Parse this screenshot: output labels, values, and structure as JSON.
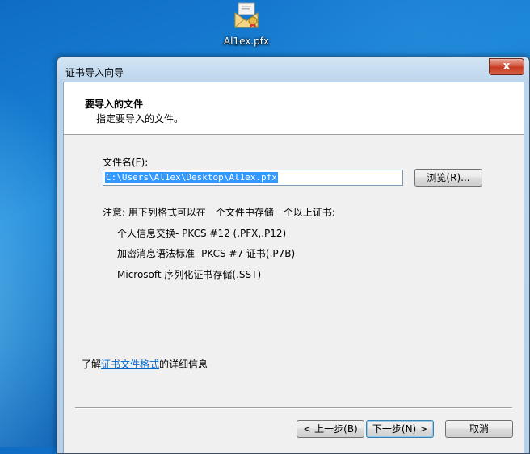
{
  "desktop": {
    "icon_label": "Al1ex.pfx",
    "icon": "certificate-envelope-icon"
  },
  "window": {
    "title": "证书导入向导",
    "close_label": "x"
  },
  "header": {
    "title": "要导入的文件",
    "subtitle": "指定要导入的文件。"
  },
  "form": {
    "file_label": "文件名(F):",
    "file_value": "C:\\Users\\Al1ex\\Desktop\\Al1ex.pfx",
    "browse_label": "浏览(R)..."
  },
  "note": {
    "text": "注意: 用下列格式可以在一个文件中存储一个以上证书:",
    "formats": [
      "个人信息交换- PKCS #12 (.PFX,.P12)",
      "加密消息语法标准- PKCS #7 证书(.P7B)",
      "Microsoft 序列化证书存储(.SST)"
    ]
  },
  "learn_more": {
    "prefix": "了解",
    "link": "证书文件格式",
    "suffix": "的详细信息"
  },
  "buttons": {
    "back": "< 上一步(B)",
    "next": "下一步(N) >",
    "cancel": "取消"
  }
}
